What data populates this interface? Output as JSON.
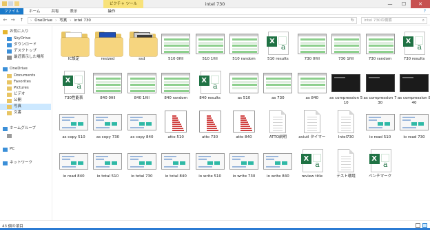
{
  "titlebar": {
    "context_tab": "ピクチャ ツール",
    "title": "intel 730",
    "minimize": "—",
    "maximize": "☐",
    "close": "✕"
  },
  "ribbon": {
    "tabs": [
      "ファイル",
      "ホーム",
      "共有",
      "表示"
    ],
    "context_tab": "操作",
    "help": "?"
  },
  "address": {
    "back": "←",
    "forward": "→",
    "up": "↑",
    "crumbs": [
      "OneDrive",
      "写真",
      "intel 730"
    ],
    "sep": "›",
    "refresh": "↻",
    "search_placeholder": "intel 730の検索"
  },
  "nav": {
    "items": [
      {
        "label": "お気に入り",
        "icon": "star-icon",
        "color": "#e6b62f"
      },
      {
        "label": "SkyDrive",
        "icon": "cloud-icon",
        "color": "#3b8fd8"
      },
      {
        "label": "ダウンロード",
        "icon": "download-icon",
        "color": "#3b8fd8"
      },
      {
        "label": "デスクトップ",
        "icon": "desktop-icon",
        "color": "#3b8fd8"
      },
      {
        "label": "最近表示した場所",
        "icon": "recent-icon",
        "color": "#8a8a8a"
      },
      {
        "label": "OneDrive",
        "icon": "cloud-icon",
        "color": "#3b8fd8"
      },
      {
        "label": "Documents",
        "icon": "folder-icon",
        "color": "#e8c564"
      },
      {
        "label": "Favorites",
        "icon": "folder-icon",
        "color": "#e8c564"
      },
      {
        "label": "Pictures",
        "icon": "folder-icon",
        "color": "#e8c564"
      },
      {
        "label": "ビデオ",
        "icon": "folder-icon",
        "color": "#e8c564"
      },
      {
        "label": "公開",
        "icon": "folder-icon",
        "color": "#e8c564"
      },
      {
        "label": "写真",
        "icon": "folder-icon",
        "color": "#e8c564"
      },
      {
        "label": "文書",
        "icon": "folder-icon",
        "color": "#e8c564"
      },
      {
        "label": "ホームグループ",
        "icon": "homegroup-icon",
        "color": "#3b8fd8"
      },
      {
        "label": "",
        "icon": "user-icon",
        "color": "#9a9a9a"
      },
      {
        "label": "PC",
        "icon": "pc-icon",
        "color": "#3b8fd8"
      },
      {
        "label": "ネットワーク",
        "icon": "network-icon",
        "color": "#3b8fd8"
      }
    ]
  },
  "files": [
    {
      "name": "IC設定",
      "type": "folder"
    },
    {
      "name": "resized",
      "type": "folder-blue"
    },
    {
      "name": "ssd",
      "type": "folder-dark"
    },
    {
      "name": "510 0fill",
      "type": "bench"
    },
    {
      "name": "510 1fill",
      "type": "bench"
    },
    {
      "name": "510 random",
      "type": "bench"
    },
    {
      "name": "510 results",
      "type": "excel"
    },
    {
      "name": "730 0fill",
      "type": "bench"
    },
    {
      "name": "730 1fill",
      "type": "bench"
    },
    {
      "name": "730 random",
      "type": "bench"
    },
    {
      "name": "730 results",
      "type": "excel"
    },
    {
      "name": "730性能表",
      "type": "excel"
    },
    {
      "name": "840 0fill",
      "type": "bench"
    },
    {
      "name": "840 1fill",
      "type": "bench"
    },
    {
      "name": "840 random",
      "type": "bench"
    },
    {
      "name": "840 results",
      "type": "excel"
    },
    {
      "name": "as 510",
      "type": "asssd"
    },
    {
      "name": "as 730",
      "type": "asssd"
    },
    {
      "name": "as 840",
      "type": "asssd"
    },
    {
      "name": "as compression 510",
      "type": "dark"
    },
    {
      "name": "as compression 730",
      "type": "dark"
    },
    {
      "name": "as compression 840",
      "type": "dark"
    },
    {
      "name": "as copy 510",
      "type": "light"
    },
    {
      "name": "as copy 730",
      "type": "light"
    },
    {
      "name": "as copy 840",
      "type": "light"
    },
    {
      "name": "atto 510",
      "type": "atto"
    },
    {
      "name": "atto 730",
      "type": "atto"
    },
    {
      "name": "atto 840",
      "type": "atto"
    },
    {
      "name": "ATTO説明",
      "type": "doc"
    },
    {
      "name": "aviutl タイマー",
      "type": "doc"
    },
    {
      "name": "Intel730",
      "type": "doc"
    },
    {
      "name": "io read 510",
      "type": "light"
    },
    {
      "name": "io read 730",
      "type": "light"
    },
    {
      "name": "io read 840",
      "type": "light"
    },
    {
      "name": "io total 510",
      "type": "light"
    },
    {
      "name": "io total 730",
      "type": "light"
    },
    {
      "name": "io total 840",
      "type": "light"
    },
    {
      "name": "io write 510",
      "type": "light"
    },
    {
      "name": "io write 730",
      "type": "light"
    },
    {
      "name": "io write 840",
      "type": "light"
    },
    {
      "name": "review title",
      "type": "excel"
    },
    {
      "name": "テスト環境",
      "type": "doc"
    },
    {
      "name": "ベンチマーク",
      "type": "excel"
    }
  ],
  "status": {
    "count": "43 個の項目"
  },
  "colors": {
    "accent": "#1979ca",
    "folder": "#e8c564",
    "excel": "#1f7244",
    "close": "#c75050",
    "context": "#f8e27a"
  }
}
